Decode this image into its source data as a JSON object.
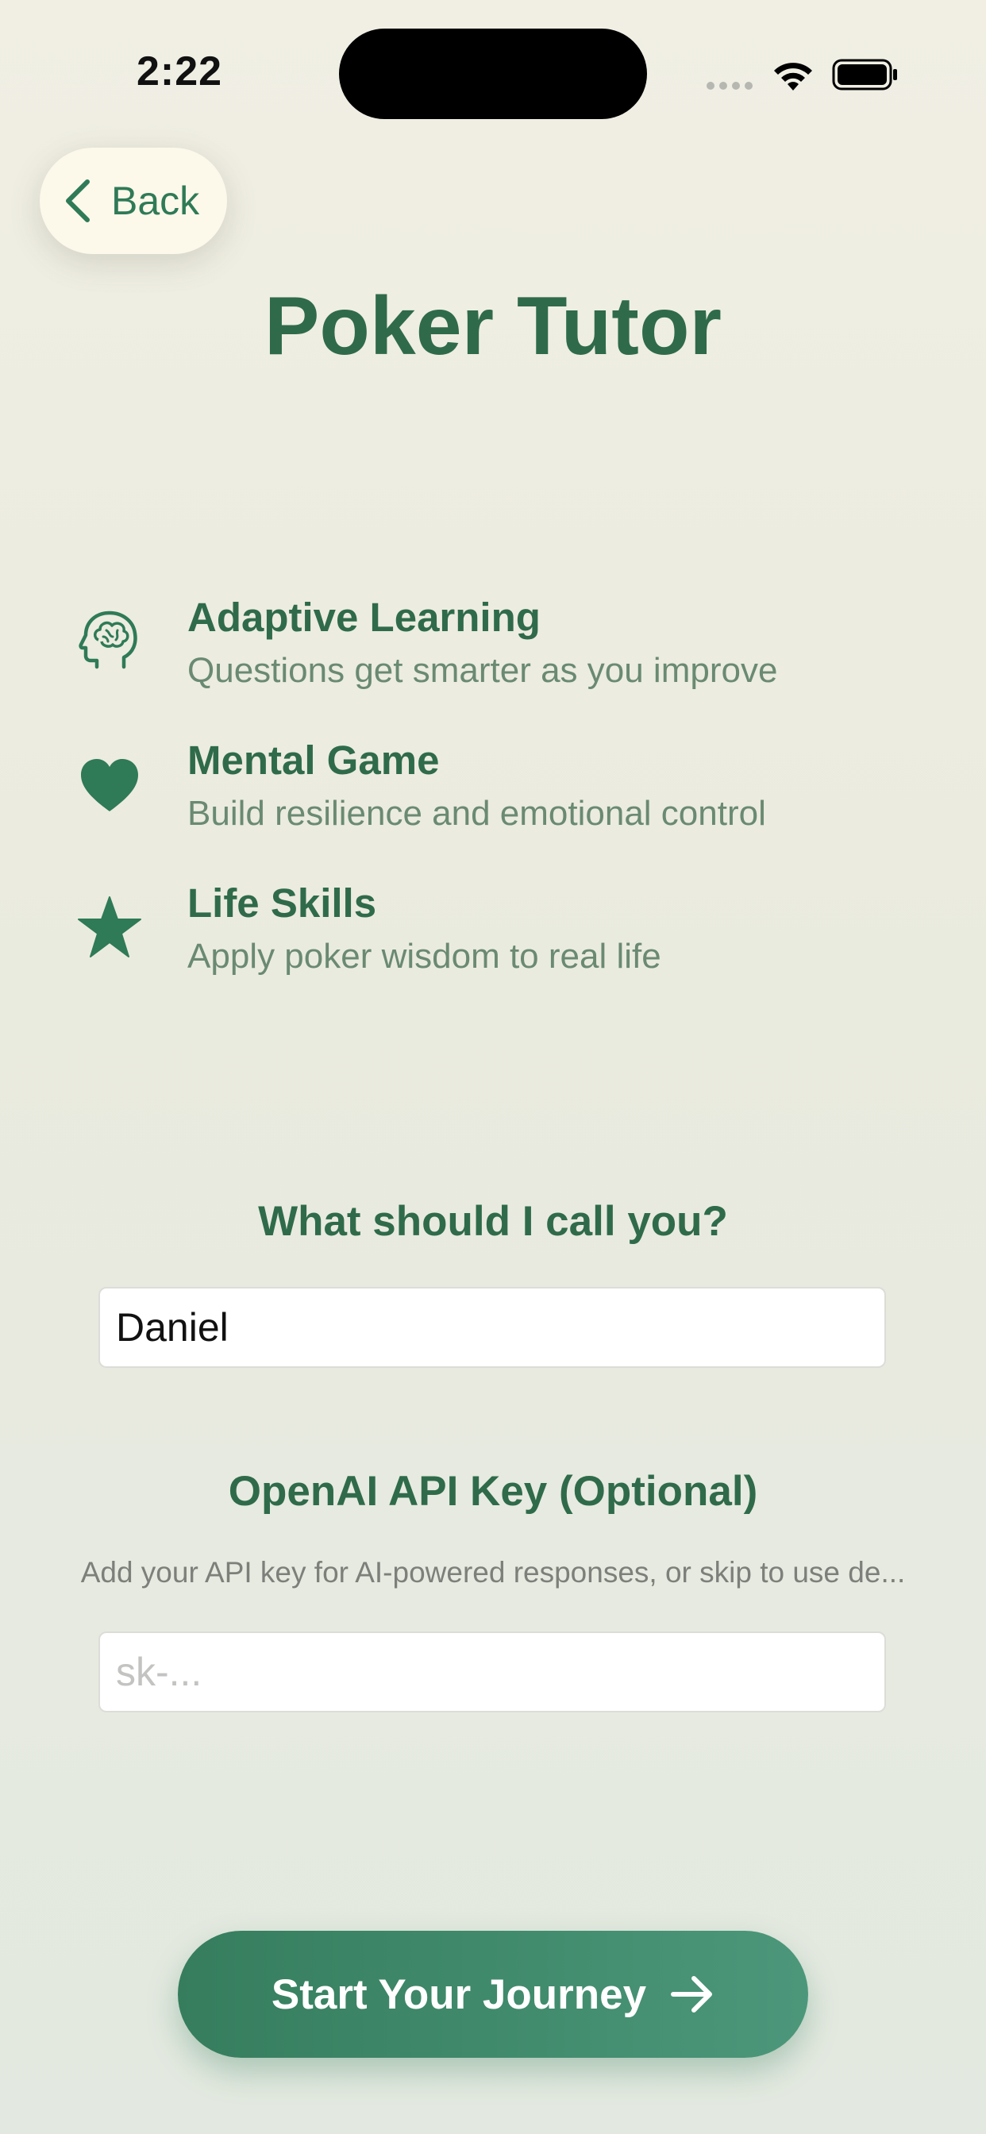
{
  "status_bar": {
    "time": "2:22"
  },
  "nav": {
    "back_label": "Back"
  },
  "title": "Poker Tutor",
  "features": [
    {
      "icon": "brain-head-icon",
      "title": "Adaptive Learning",
      "description": "Questions get smarter as you improve"
    },
    {
      "icon": "heart-icon",
      "title": "Mental Game",
      "description": "Build resilience and emotional control"
    },
    {
      "icon": "star-icon",
      "title": "Life Skills",
      "description": "Apply poker wisdom to real life"
    }
  ],
  "name_field": {
    "label": "What should I call you?",
    "value": "Daniel"
  },
  "api_field": {
    "label": "OpenAI API Key (Optional)",
    "help": "Add your API key for AI-powered responses, or skip to use de...",
    "placeholder": "sk-..."
  },
  "cta": {
    "label": "Start Your Journey"
  },
  "colors": {
    "accent": "#2f6b4b",
    "button": "#3a8463",
    "background": "#eeede2"
  }
}
